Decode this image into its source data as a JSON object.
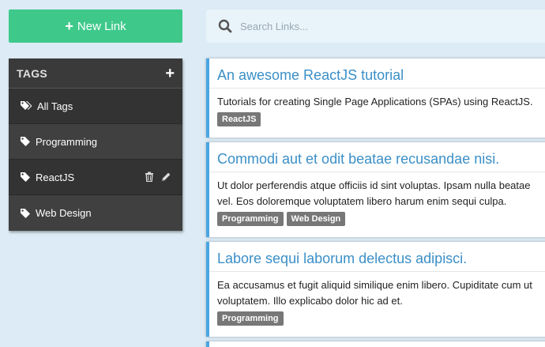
{
  "new_link": {
    "label": "New Link"
  },
  "search": {
    "placeholder": "Search Links..."
  },
  "tags": {
    "title": "TAGS",
    "items": [
      {
        "label": "All Tags"
      },
      {
        "label": "Programming"
      },
      {
        "label": "ReactJS"
      },
      {
        "label": "Web Design"
      }
    ]
  },
  "links": [
    {
      "title": "An awesome ReactJS tutorial",
      "desc_line1": "Tutorials for creating Single Page Applications (SPAs) using ReactJS.",
      "desc_line2": "",
      "tags": [
        "ReactJS"
      ]
    },
    {
      "title": "Commodi aut et odit beatae recusandae nisi.",
      "desc_line1": "Ut dolor perferendis atque officiis id sint voluptas. Ipsam nulla beatae",
      "desc_line2": "vel. Eos doloremque voluptatem libero harum enim sequi culpa.",
      "tags": [
        "Programming",
        "Web Design"
      ]
    },
    {
      "title": "Labore sequi laborum delectus adipisci.",
      "desc_line1": "Ea accusamus et fugit aliquid similique enim libero. Cupiditate cum ut",
      "desc_line2": "voluptatem. Illo explicabo dolor hic ad et.",
      "tags": [
        "Programming"
      ]
    }
  ],
  "colors": {
    "accent_green": "#3ec98b",
    "link_blue": "#3b8fc7",
    "card_border": "#4aa6e0"
  }
}
